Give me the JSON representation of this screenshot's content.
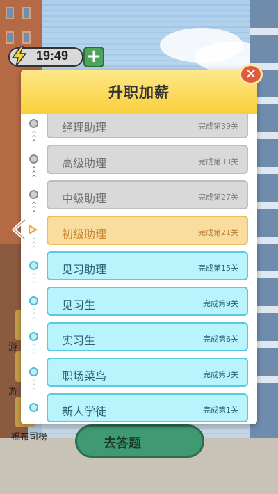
{
  "hud": {
    "time": "19:49",
    "energy_icon": "lightning-bolt-icon",
    "add_label": "+"
  },
  "side_menu": {
    "item1_label": "游",
    "item2_label": "游",
    "leaderboard_label": "福布司榜"
  },
  "bottom_button": {
    "label": "去答题"
  },
  "modal": {
    "title": "升职加薪",
    "close_icon": "close-icon",
    "close_label": "✕"
  },
  "colors": {
    "header_yellow": "#f9cf3a",
    "locked_gray": "#d9d9d9",
    "current_orange": "#f9dd9e",
    "done_cyan": "#b9f3fb",
    "close_red": "#e05a3e"
  },
  "ranks": [
    {
      "name": "经理助理",
      "condition": "完成第39关",
      "status": "locked"
    },
    {
      "name": "高级助理",
      "condition": "完成第33关",
      "status": "locked"
    },
    {
      "name": "中级助理",
      "condition": "完成第27关",
      "status": "locked"
    },
    {
      "name": "初级助理",
      "condition": "完成第21关",
      "status": "current"
    },
    {
      "name": "见习助理",
      "condition": "完成第15关",
      "status": "done"
    },
    {
      "name": "见习生",
      "condition": "完成第9关",
      "status": "done"
    },
    {
      "name": "实习生",
      "condition": "完成第6关",
      "status": "done"
    },
    {
      "name": "职场菜鸟",
      "condition": "完成第3关",
      "status": "done"
    },
    {
      "name": "新人学徒",
      "condition": "完成第1关",
      "status": "done"
    }
  ]
}
